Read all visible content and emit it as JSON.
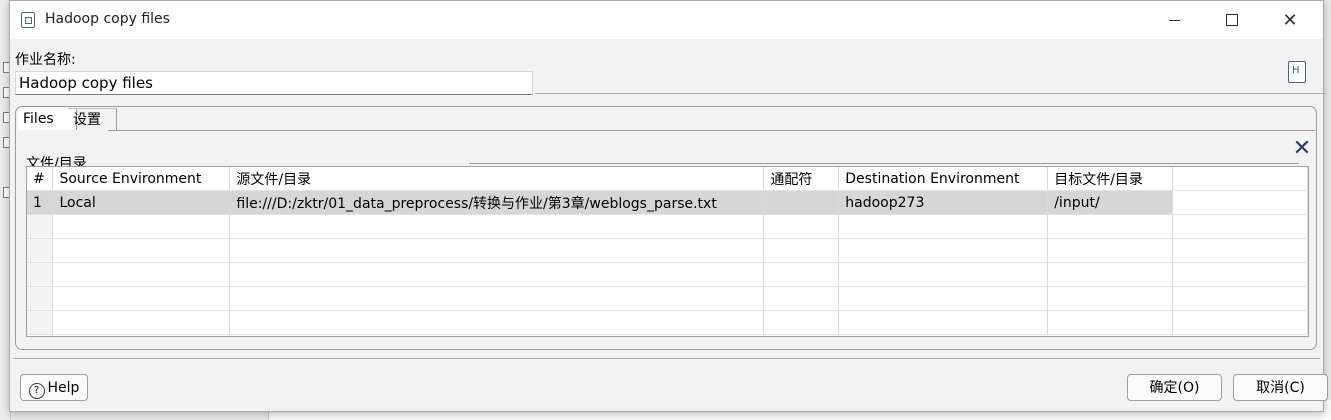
{
  "window": {
    "title": "Hadoop copy files"
  },
  "job": {
    "name_label": "作业名称:",
    "name_value": "Hadoop copy files"
  },
  "tabs": [
    {
      "label": "Files"
    },
    {
      "label": "设置"
    }
  ],
  "files_group": {
    "title": "文件/目录",
    "columns": [
      "#",
      "Source Environment",
      "源文件/目录",
      "通配符",
      "Destination Environment",
      "目标文件/目录"
    ],
    "rows": [
      [
        "1",
        "Local",
        "file:///D:/zktr/01_data_preprocess/转换与作业/第3章/weblogs_parse.txt",
        "",
        "hadoop273",
        "/input/"
      ]
    ]
  },
  "buttons": {
    "help": "Help",
    "ok": "确定(O)",
    "cancel": "取消(C)"
  },
  "icons": {
    "app": "hadoop-file-icon",
    "job": "hadoop-job-icon",
    "delete": "delete-x-icon",
    "help": "question-circle-icon"
  }
}
